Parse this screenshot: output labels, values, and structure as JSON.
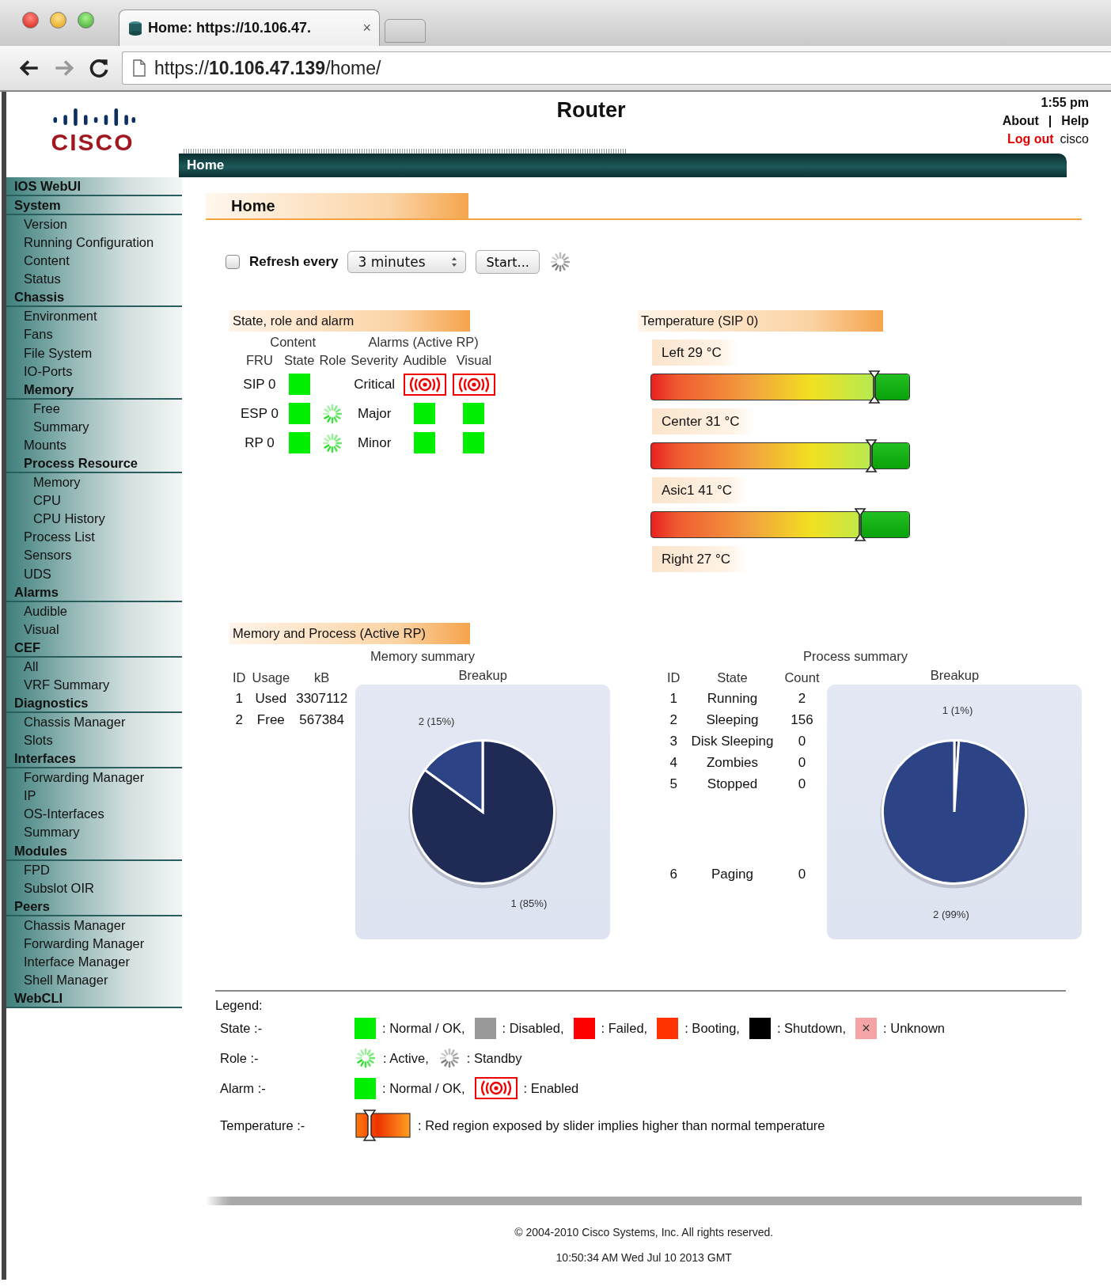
{
  "browser": {
    "tab_title": "Home: https://10.106.47.",
    "tab_close": "×",
    "url": "https://**10.106.47.139**/home/"
  },
  "header": {
    "logo_text": "CISCO",
    "title": "Router",
    "time": "1:55 pm",
    "links": [
      "About",
      "Help"
    ],
    "separator": "|",
    "logout": "Log out",
    "user": "cisco",
    "band_label": "Home"
  },
  "sidebar": [
    {
      "label": "IOS WebUI"
    },
    {
      "label": "System",
      "children": [
        {
          "label": "Version"
        },
        {
          "label": "Running Configuration"
        },
        {
          "label": "Content"
        },
        {
          "label": "Status"
        }
      ]
    },
    {
      "label": "Chassis",
      "children": [
        {
          "label": "Environment"
        },
        {
          "label": "Fans"
        },
        {
          "label": "File System"
        },
        {
          "label": "IO-Ports"
        },
        {
          "label": "Memory",
          "children": [
            {
              "label": "Free"
            },
            {
              "label": "Summary"
            }
          ]
        },
        {
          "label": "Mounts"
        },
        {
          "label": "Process Resource",
          "children": [
            {
              "label": "Memory"
            },
            {
              "label": "CPU"
            },
            {
              "label": "CPU History"
            }
          ]
        },
        {
          "label": "Process List"
        },
        {
          "label": "Sensors"
        },
        {
          "label": "UDS"
        }
      ]
    },
    {
      "label": "Alarms",
      "children": [
        {
          "label": "Audible"
        },
        {
          "label": "Visual"
        }
      ]
    },
    {
      "label": "CEF",
      "children": [
        {
          "label": "All"
        },
        {
          "label": "VRF Summary"
        }
      ]
    },
    {
      "label": "Diagnostics",
      "children": [
        {
          "label": "Chassis Manager"
        },
        {
          "label": "Slots"
        }
      ]
    },
    {
      "label": "Interfaces",
      "children": [
        {
          "label": "Forwarding Manager"
        },
        {
          "label": "IP"
        },
        {
          "label": "OS-Interfaces"
        },
        {
          "label": "Summary"
        }
      ]
    },
    {
      "label": "Modules",
      "children": [
        {
          "label": "FPD"
        },
        {
          "label": "Subslot OIR"
        }
      ]
    },
    {
      "label": "Peers",
      "children": [
        {
          "label": "Chassis Manager"
        },
        {
          "label": "Forwarding Manager"
        },
        {
          "label": "Interface Manager"
        },
        {
          "label": "Shell Manager"
        }
      ]
    },
    {
      "label": "WebCLI"
    }
  ],
  "page_title": "Home",
  "refresh": {
    "checked": false,
    "label": "Refresh every",
    "interval": "3 minutes",
    "button": "Start..."
  },
  "status": {
    "title": "State, role and alarm",
    "group_content": "Content",
    "group_alarms": "Alarms (Active RP)",
    "columns": [
      "FRU",
      "State",
      "Role",
      "Severity",
      "Audible",
      "Visual"
    ],
    "rows": [
      {
        "fru": "SIP 0",
        "state_ok": true,
        "role_active": false,
        "severity": "Critical",
        "audible_enabled": true,
        "visual_enabled": true
      },
      {
        "fru": "ESP 0",
        "state_ok": true,
        "role_active": true,
        "severity": "Major",
        "audible_enabled": false,
        "visual_enabled": false
      },
      {
        "fru": "RP 0",
        "state_ok": true,
        "role_active": true,
        "severity": "Minor",
        "audible_enabled": false,
        "visual_enabled": false
      }
    ]
  },
  "temperature": {
    "title": "Temperature (SIP 0)",
    "sensors": [
      {
        "label": "Left 29 °C",
        "level": 0.865
      },
      {
        "label": "Center 31 °C",
        "level": 0.853
      },
      {
        "label": "Asic1 41 °C",
        "level": 0.81
      },
      {
        "label": "Right 27 °C"
      }
    ]
  },
  "memory_process": {
    "title": "Memory and Process (Active RP)",
    "memory": {
      "title": "Memory summary",
      "columns": [
        "ID",
        "Usage",
        "kB"
      ],
      "breakup_label": "Breakup",
      "rows": [
        {
          "no": "1",
          "usage": "Used",
          "kb": "3307112"
        },
        {
          "no": "2",
          "usage": "Free",
          "kb": "567384"
        }
      ],
      "chart_data": {
        "type": "pie",
        "values": [
          85,
          15
        ],
        "value_labels": [
          "1 (85%)",
          "2 (15%)"
        ]
      }
    },
    "process": {
      "title": "Process summary",
      "columns": [
        "ID",
        "State",
        "Count"
      ],
      "breakup_label": "Breakup",
      "rows": [
        {
          "no": "1",
          "state": "Running",
          "count": "2",
          "gap_before": false
        },
        {
          "no": "2",
          "state": "Sleeping",
          "count": "156",
          "gap_before": false
        },
        {
          "no": "3",
          "state": "Disk Sleeping",
          "count": "0",
          "gap_before": false
        },
        {
          "no": "4",
          "state": "Zombies",
          "count": "0",
          "gap_before": false
        },
        {
          "no": "5",
          "state": "Stopped",
          "count": "0",
          "gap_before": false
        },
        {
          "no": "6",
          "state": "Paging",
          "count": "0",
          "gap_before": true
        }
      ],
      "chart_data": {
        "type": "pie",
        "values": [
          1,
          99
        ],
        "value_labels": [
          "1 (1%)",
          "2 (99%)"
        ]
      }
    }
  },
  "legend": {
    "title": "Legend:",
    "rows": [
      {
        "label": "State :-",
        "items": [
          {
            "kind": "swatch",
            "color": "#00ee00",
            "text": ": Normal / OK,"
          },
          {
            "kind": "swatch",
            "color": "#999999",
            "text": ": Disabled,"
          },
          {
            "kind": "swatch",
            "color": "#ff0000",
            "text": ": Failed,"
          },
          {
            "kind": "swatch",
            "color": "#ff3300",
            "text": ": Booting,"
          },
          {
            "kind": "swatch",
            "color": "#000000",
            "text": ": Shutdown,"
          },
          {
            "kind": "swatch",
            "color": "#f4a4a4",
            "mark": "×",
            "text": ": Unknown"
          }
        ]
      },
      {
        "label": "Role :-",
        "items": [
          {
            "kind": "spinner-active",
            "text": ": Active,"
          },
          {
            "kind": "spinner-standby",
            "text": ": Standby"
          }
        ]
      },
      {
        "label": "Alarm :-",
        "items": [
          {
            "kind": "swatch",
            "color": "#00ee00",
            "text": ": Normal / OK,"
          },
          {
            "kind": "alarm",
            "text": ": Enabled"
          }
        ]
      },
      {
        "label": "Temperature :-",
        "items": [
          {
            "kind": "gauge",
            "text": ": Red region exposed by slider implies higher than normal temperature"
          }
        ]
      }
    ]
  },
  "footer": {
    "copyright": "© 2004-2010 Cisco Systems, Inc. All rights reserved.",
    "timestamp": "10:50:34 AM Wed Jul 10 2013 GMT"
  }
}
